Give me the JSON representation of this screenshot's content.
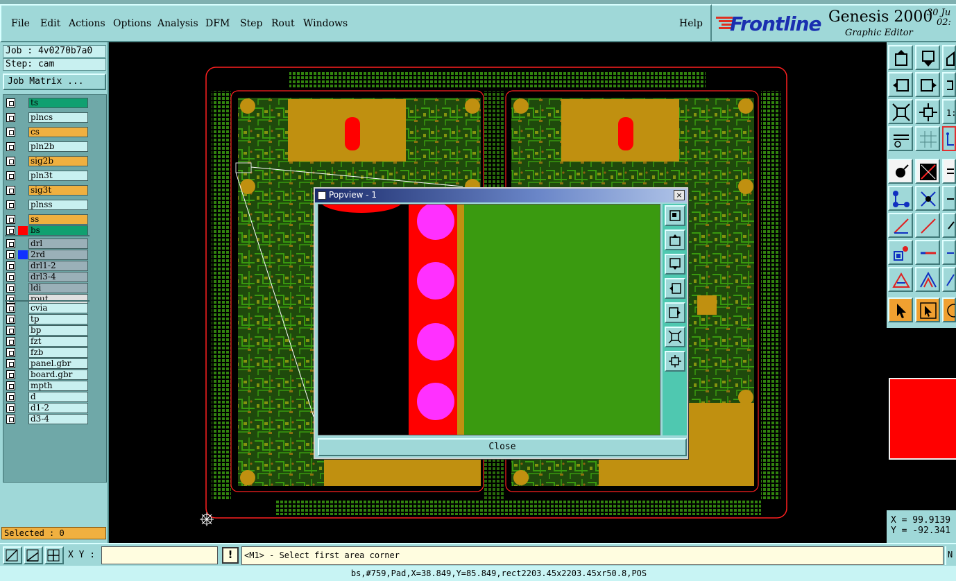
{
  "menubar": {
    "items": [
      {
        "label": "File"
      },
      {
        "label": "Edit"
      },
      {
        "label": "Actions"
      },
      {
        "label": "Options"
      },
      {
        "label": "Analysis"
      },
      {
        "label": "DFM"
      },
      {
        "label": "Step"
      },
      {
        "label": "Rout"
      },
      {
        "label": "Windows"
      }
    ],
    "help": "Help"
  },
  "brand": {
    "logo": "Frontline",
    "title": "Genesis 2000",
    "subtitle": "Graphic Editor",
    "date_line1": "30 Ju",
    "date_line2": "02:"
  },
  "job": {
    "job_line": "Job : 4v0270b7a0",
    "step_line": "Step: cam",
    "matrix_button": "Job Matrix ..."
  },
  "layers": {
    "group1": [
      {
        "name": "ts",
        "color": "#10a070",
        "swatch": ""
      },
      {
        "name": "plncs",
        "color": "#c8f0f0",
        "swatch": ""
      },
      {
        "name": "cs",
        "color": "#f0b040",
        "swatch": ""
      },
      {
        "name": "pln2b",
        "color": "#c8f0f0",
        "swatch": ""
      },
      {
        "name": "sig2b",
        "color": "#f0b040",
        "swatch": ""
      },
      {
        "name": "pln3t",
        "color": "#c8f0f0",
        "swatch": ""
      },
      {
        "name": "sig3t",
        "color": "#f0b040",
        "swatch": ""
      },
      {
        "name": "plnss",
        "color": "#c8f0f0",
        "swatch": ""
      },
      {
        "name": "ss",
        "color": "#f0b040",
        "swatch": ""
      },
      {
        "name": "bs",
        "color": "#10a070",
        "swatch": "#ff0000"
      }
    ],
    "group2": [
      {
        "name": "drl",
        "color": "#9ab0b8",
        "swatch": ""
      },
      {
        "name": "2rd",
        "color": "#9ab0b8",
        "swatch": "#1030ff"
      },
      {
        "name": "drl1-2",
        "color": "#9ab0b8",
        "swatch": ""
      },
      {
        "name": "drl3-4",
        "color": "#9ab0b8",
        "swatch": ""
      },
      {
        "name": "ldi",
        "color": "#9ab0b8",
        "swatch": ""
      },
      {
        "name": "rout",
        "color": "#e0e0e0",
        "swatch": ""
      }
    ],
    "group3": [
      {
        "name": "cvia",
        "color": "#c8f0f0",
        "swatch": ""
      },
      {
        "name": "tp",
        "color": "#c8f0f0",
        "swatch": ""
      },
      {
        "name": "bp",
        "color": "#c8f0f0",
        "swatch": ""
      },
      {
        "name": "fzt",
        "color": "#c8f0f0",
        "swatch": ""
      },
      {
        "name": "fzb",
        "color": "#c8f0f0",
        "swatch": ""
      },
      {
        "name": "panel.gbr",
        "color": "#c8f0f0",
        "swatch": ""
      },
      {
        "name": "board.gbr",
        "color": "#c8f0f0",
        "swatch": ""
      },
      {
        "name": "mpth",
        "color": "#c8f0f0",
        "swatch": ""
      },
      {
        "name": "d",
        "color": "#c8f0f0",
        "swatch": ""
      },
      {
        "name": "d1-2",
        "color": "#c8f0f0",
        "swatch": ""
      },
      {
        "name": "d3-4",
        "color": "#c8f0f0",
        "swatch": ""
      }
    ]
  },
  "selected": "Selected : 0",
  "popview": {
    "title": "Popview - 1",
    "close_x": "×",
    "close_button": "Close"
  },
  "coords": {
    "x": "X = 99.9139",
    "y": "Y = -92.341"
  },
  "bottom": {
    "xy_label": "X Y :",
    "xy_value": "",
    "excl": "!",
    "prompt": "<M1> - Select first area corner",
    "right_btn": "N"
  },
  "status": "bs,#759,Pad,X=38.849,Y=85.849,rect2203.45x2203.45xr50.8,POS",
  "colors": {
    "panel": "#9fd8d8",
    "board_green": "#3a9a10",
    "copper": "#c09010",
    "red": "#ff0000",
    "magenta": "#ff30ff"
  }
}
